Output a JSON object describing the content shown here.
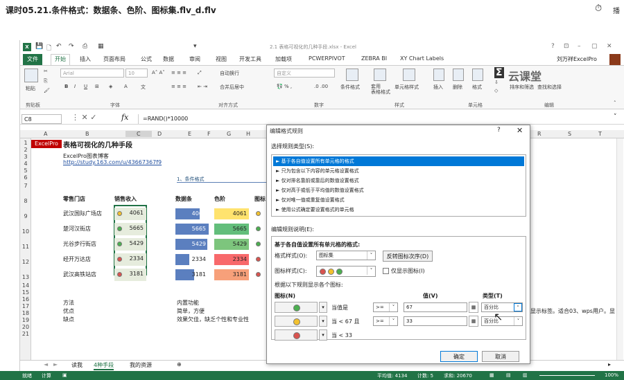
{
  "video": {
    "title": "课时05.21.条件格式：数据条、色阶、图标集.flv_d.flv",
    "play_label": "播"
  },
  "excel": {
    "window_title": "2.1 表格可视化的几种手段.xlsx - Excel",
    "win_controls": [
      "?",
      "⊡",
      "–",
      "▢",
      "✕"
    ],
    "tabs": [
      "文件",
      "开始",
      "插入",
      "页面布局",
      "公式",
      "数据",
      "审阅",
      "视图",
      "开发工具",
      "加载项",
      "PCWERPIVOT",
      "ZEBRA BI",
      "XY Chart Labels"
    ],
    "user": "刘万祥ExcelPro",
    "ribbon": {
      "paste": "粘贴",
      "font_name": "Arial",
      "font_size": "10",
      "wrap": "自动换行",
      "merge": "合并后居中",
      "number_format": "自定义",
      "conditional": "条件格式",
      "table_fmt": "套用\n表格格式",
      "cell_style": "单元格样式",
      "insert": "插入",
      "delete": "删除",
      "format": "格式",
      "sort": "排序和筛选",
      "find": "查找和选择",
      "groups": [
        "剪贴板",
        "字体",
        "对齐方式",
        "数字",
        "样式",
        "单元格",
        "编辑"
      ],
      "brand": "云课堂"
    },
    "name_box": "C8",
    "formula": "=RAND()*10000",
    "columns": [
      "A",
      "B",
      "C",
      "D",
      "E",
      "F",
      "G",
      "H",
      "R",
      "S",
      "T"
    ],
    "rows": [
      "1",
      "2",
      "3",
      "4",
      "5",
      "6",
      "7",
      "8",
      "9",
      "10",
      "11",
      "12",
      "13",
      "14",
      "15",
      "16",
      "17",
      "18",
      "19",
      "20",
      "21"
    ],
    "sheet": {
      "badge": "ExcelPro",
      "title": "表格可视化的几种手段",
      "subtitle": "ExcelPro图表博客",
      "link": "http://study.163.com/u/43667367f9",
      "section": "1、条件格式",
      "headers": [
        "零售门店",
        "销售收入",
        "数据条",
        "色阶",
        "图标"
      ],
      "stores": [
        {
          "name": "武汉国际广场店",
          "value": "4061",
          "bar": 0.72,
          "dot": "#f2c12e",
          "scale": "#ffe36e"
        },
        {
          "name": "楚河汉街店",
          "value": "5665",
          "bar": 1.0,
          "dot": "#4caf50",
          "scale": "#63be7b"
        },
        {
          "name": "光谷步行街店",
          "value": "5429",
          "bar": 0.95,
          "dot": "#4caf50",
          "scale": "#7dc57d"
        },
        {
          "name": "经开万达店",
          "value": "2334",
          "bar": 0.41,
          "dot": "#d9534f",
          "scale": "#f8696b"
        },
        {
          "name": "武汉高铁站店",
          "value": "3181",
          "bar": 0.56,
          "dot": "#d9534f",
          "scale": "#f7a07a"
        }
      ],
      "notes": {
        "labels": [
          "方法",
          "优点",
          "缺点"
        ],
        "values": [
          "内置功能",
          "简单，方便",
          "效果欠佳，缺乏个性和专业性"
        ]
      },
      "right_text": "显示标签。适合03、wps用户。显"
    },
    "sheet_tabs": [
      "读我",
      "4种手段",
      "我的资源"
    ],
    "status": {
      "ready": "就绪",
      "calc": "计算",
      "avg": "平均值: 4134",
      "count": "计数: 5",
      "sum": "求和: 20670",
      "zoom": "100%"
    }
  },
  "dialog": {
    "title": "编辑格式规则",
    "help": "?",
    "close": "✕",
    "select_type_label": "选择规则类型(S):",
    "types": [
      "► 基于各自值设置所有单元格的格式",
      "► 只为包含以下内容的单元格设置格式",
      "► 仅对排名靠前或靠后的数值设置格式",
      "► 仅对高于或低于平均值的数值设置格式",
      "► 仅对唯一值或重复值设置格式",
      "► 使用公式确定要设置格式的单元格"
    ],
    "edit_label": "编辑规则说明(E):",
    "desc_heading": "基于各自值设置所有单元格的格式:",
    "format_style_label": "格式样式(O):",
    "format_style_value": "图标集",
    "reverse_btn": "反转图标次序(D)",
    "icon_style_label": "图标样式(C):",
    "show_icon_only": "仅显示图标(I)",
    "rule_label": "根据以下规则显示各个图标:",
    "col_icon": "图标(N)",
    "col_value": "值(V)",
    "col_type": "类型(T)",
    "rules": [
      {
        "color": "#4caf50",
        "cond": "当值是",
        "op": ">=",
        "value": "67",
        "type": "百分比"
      },
      {
        "color": "#f2c12e",
        "cond": "当 < 67 且",
        "op": ">=",
        "value": "33",
        "type": "百分比"
      },
      {
        "color": "#d9534f",
        "cond": "当 < 33",
        "op": "",
        "value": "",
        "type": ""
      }
    ],
    "ok": "确定",
    "cancel": "取消"
  }
}
